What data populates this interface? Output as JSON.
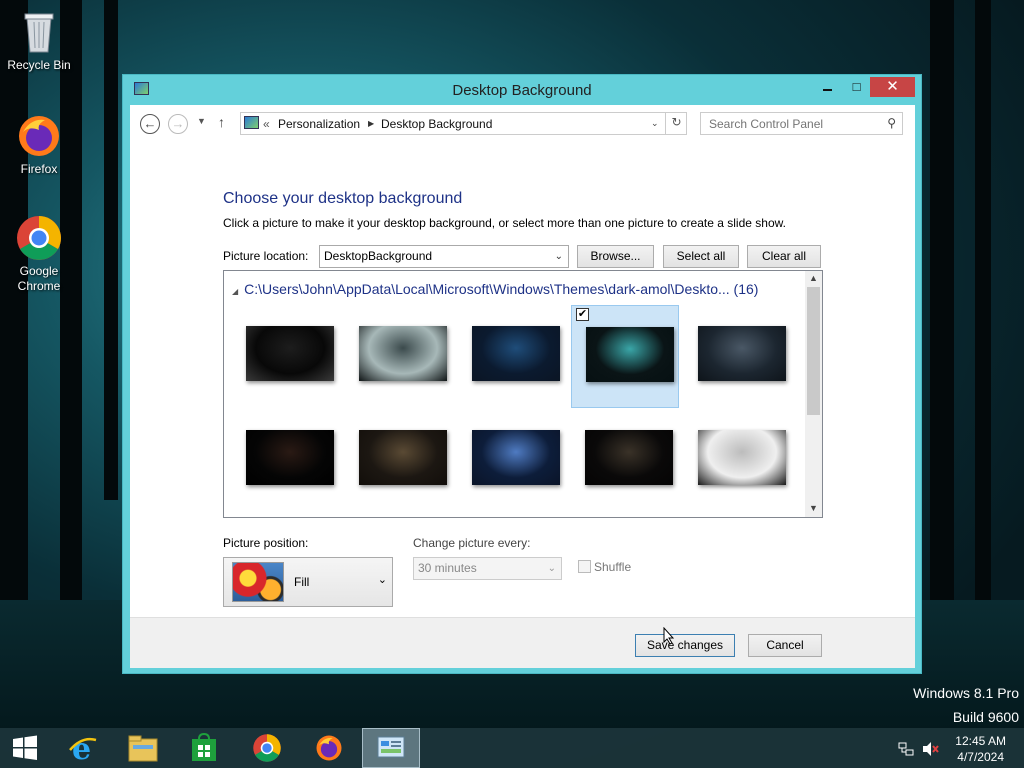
{
  "desktop": {
    "icons": [
      {
        "label": "Recycle Bin"
      },
      {
        "label": "Firefox"
      },
      {
        "label": "Google Chrome"
      }
    ],
    "watermark_line1": "Windows 8.1 Pro",
    "watermark_line2": "Build 9600"
  },
  "window": {
    "title": "Desktop Background",
    "minimize_glyph": "▭",
    "maximize_glyph": "□",
    "close_glyph": "✕"
  },
  "address_bar": {
    "breadcrumb_prefix": "«",
    "crumb1": "Personalization",
    "separator": "▶",
    "crumb2": "Desktop Background",
    "search_placeholder": "Search Control Panel"
  },
  "content": {
    "heading": "Choose your desktop background",
    "subtext": "Click a picture to make it your desktop background, or select more than one picture to create a slide show.",
    "picture_location_label": "Picture location:",
    "picture_location_value": "DesktopBackground",
    "browse_label": "Browse...",
    "select_all_label": "Select all",
    "clear_all_label": "Clear all",
    "group_header": "C:\\Users\\John\\AppData\\Local\\Microsoft\\Windows\\Themes\\dark-amol\\Deskto... (16)",
    "thumbnails": [
      {
        "checked": false,
        "colors": [
          "#080808",
          "#1d1d1d",
          "#3a3a3a"
        ]
      },
      {
        "checked": false,
        "colors": [
          "#a7b8b8",
          "#3b4a4c",
          "#101516"
        ]
      },
      {
        "checked": false,
        "colors": [
          "#0b1a2f",
          "#1f4d7a",
          "#0b1524"
        ]
      },
      {
        "checked": true,
        "colors": [
          "#0a1416",
          "#3aa6a8",
          "#061012"
        ]
      },
      {
        "checked": false,
        "colors": [
          "#1c2630",
          "#4a5866",
          "#0e141a"
        ]
      },
      {
        "checked": false,
        "colors": [
          "#050505",
          "#2a1a14",
          "#000000"
        ]
      },
      {
        "checked": false,
        "colors": [
          "#1c1712",
          "#5a4a34",
          "#120e0a"
        ]
      },
      {
        "checked": false,
        "colors": [
          "#0d1d3a",
          "#4f7bc2",
          "#0a1428"
        ]
      },
      {
        "checked": false,
        "colors": [
          "#0a0909",
          "#3a3228",
          "#050404"
        ]
      },
      {
        "checked": false,
        "colors": [
          "#efefef",
          "#bcbcbc",
          "#1a1a1a"
        ]
      }
    ],
    "picture_position_label": "Picture position:",
    "picture_position_value": "Fill",
    "change_every_label": "Change picture every:",
    "change_every_value": "30 minutes",
    "shuffle_label": "Shuffle"
  },
  "footer": {
    "save_label": "Save changes",
    "cancel_label": "Cancel"
  },
  "taskbar": {
    "time": "12:45 AM",
    "date": "4/7/2024"
  }
}
